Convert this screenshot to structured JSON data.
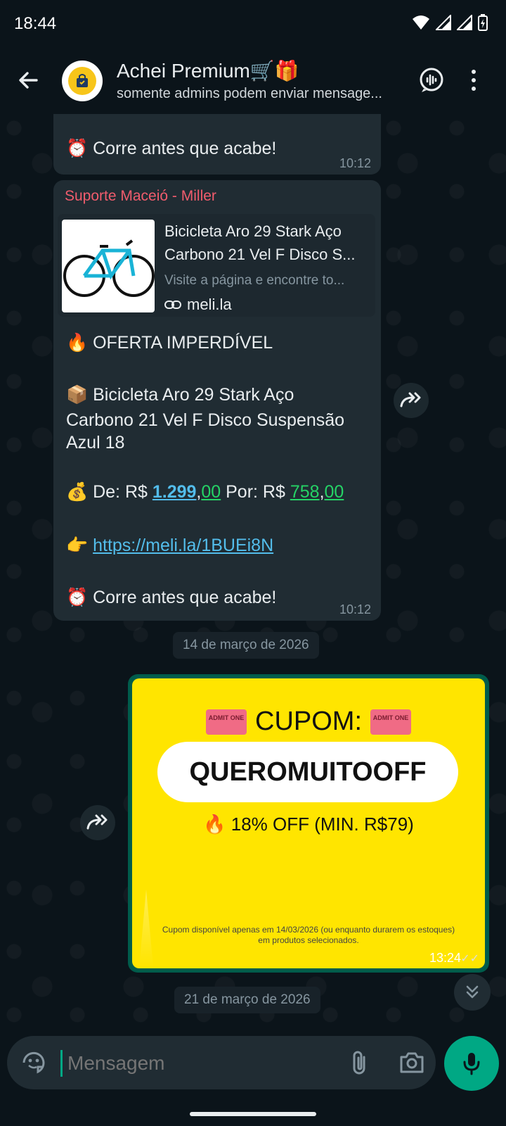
{
  "status_bar": {
    "time": "18:44"
  },
  "header": {
    "title": "Achei Premium🛒🎁",
    "subtitle": "somente admins podem enviar mensage...",
    "icons": [
      "back-arrow-icon",
      "avatar",
      "voice-chat-icon",
      "more-vert-icon"
    ]
  },
  "messages": {
    "m1": {
      "text": "Corre antes que acabe!",
      "emoji": "⏰",
      "time": "10:12"
    },
    "m2": {
      "sender": "Suporte Maceió - Miller",
      "preview": {
        "title_line1": "Bicicleta Aro 29 Stark Aço",
        "title_line2": "Carbono 21 Vel F Disco S...",
        "description": "Visite a página e encontre to...",
        "domain": "meli.la"
      },
      "offer_emoji": "🔥",
      "offer": "OFERTA IMPERDÍVEL",
      "product_emoji": "📦",
      "product_line1": "Bicicleta Aro 29 Stark Aço",
      "product_line2": "Carbono 21 Vel F Disco Suspensão",
      "product_line3": "Azul 18",
      "price_emoji": "💰",
      "price_from_label": "De: R$ ",
      "price_from_int": "1.299",
      "price_from_sep": ",",
      "price_from_dec": "00",
      "price_to_label": " Por: R$ ",
      "price_to_int": "758",
      "price_to_sep": ",",
      "price_to_dec": "00",
      "link_emoji": "👉",
      "link": "https://meli.la/1BUEi8N",
      "closing_emoji": "⏰",
      "closing": "Corre antes que acabe!",
      "time": "10:12"
    },
    "date1": "14 de março de 2026",
    "m3": {
      "coupon_label": "CUPOM:",
      "ticket_text": "ADMIT ONE",
      "code": "QUEROMUITOOFF",
      "off_emoji": "🔥",
      "off_text": "18% OFF (MIN. R$79)",
      "note": "Cupom disponível apenas em 14/03/2026 (ou enquanto durarem os estoques) em produtos selecionados.",
      "time": "13:24"
    },
    "date2": "21 de março de 2026"
  },
  "composer": {
    "placeholder": "Mensagem"
  }
}
